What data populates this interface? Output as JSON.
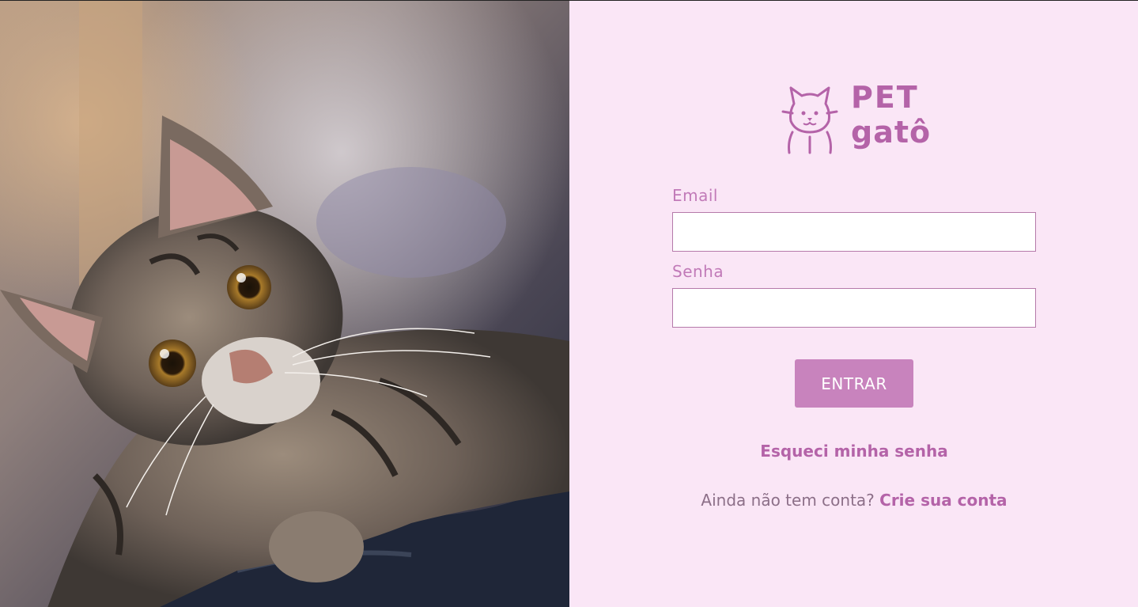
{
  "photo": {
    "description_icon": "cat-photo"
  },
  "logo": {
    "line1": "PET",
    "line2": "gatô",
    "icon": "cat-face-icon"
  },
  "form": {
    "email_label": "Email",
    "email_value": "",
    "password_label": "Senha",
    "password_value": "",
    "submit_label": "ENTRAR",
    "forgot_label": "Esqueci minha senha",
    "signup_prompt": "Ainda não tem conta?",
    "signup_link": "Crie sua conta"
  },
  "colors": {
    "panel_background": "#fae6f6",
    "accent": "#c883bd",
    "link": "#b463a8",
    "label": "#c17ab8"
  }
}
